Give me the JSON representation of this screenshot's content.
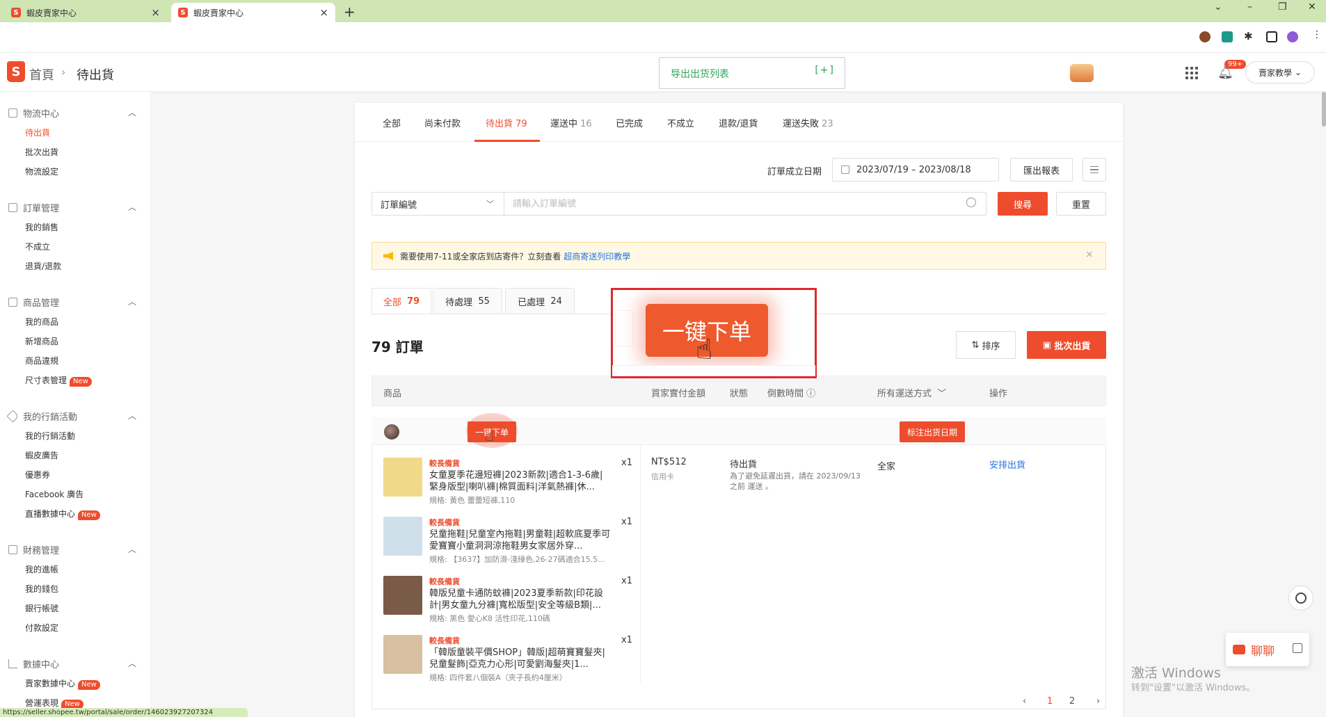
{
  "browser": {
    "tabs": [
      {
        "label": "蝦皮賣家中心"
      },
      {
        "label": "蝦皮賣家中心"
      }
    ],
    "new_tab": "+",
    "status_url": "https://seller.shopee.tw/portal/sale/order/146023927207324"
  },
  "header": {
    "breadcrumb_home": "首頁",
    "breadcrumb_sep": "›",
    "breadcrumb_current": "待出貨",
    "export_list_label": "导出出货列表",
    "export_list_plus": "[+]",
    "notif_badge": "99+",
    "seller_edu": "賣家教學"
  },
  "sidebar": {
    "sections": [
      {
        "title": "物流中心",
        "items": [
          {
            "label": "待出貨"
          },
          {
            "label": "批次出貨"
          },
          {
            "label": "物流設定"
          }
        ]
      },
      {
        "title": "訂單管理",
        "items": [
          {
            "label": "我的銷售"
          },
          {
            "label": "不成立"
          },
          {
            "label": "退貨/退款"
          }
        ]
      },
      {
        "title": "商品管理",
        "items": [
          {
            "label": "我的商品"
          },
          {
            "label": "新增商品"
          },
          {
            "label": "商品違規"
          },
          {
            "label": "尺寸表管理",
            "badge": "New"
          }
        ]
      },
      {
        "title": "我的行銷活動",
        "items": [
          {
            "label": "我的行銷活動"
          },
          {
            "label": "蝦皮廣告"
          },
          {
            "label": "優惠券"
          },
          {
            "label": "Facebook 廣告"
          },
          {
            "label": "直播數據中心",
            "badge": "New"
          }
        ]
      },
      {
        "title": "財務管理",
        "items": [
          {
            "label": "我的進帳"
          },
          {
            "label": "我的錢包"
          },
          {
            "label": "銀行帳號"
          },
          {
            "label": "付款設定"
          }
        ]
      },
      {
        "title": "數據中心",
        "items": [
          {
            "label": "賣家數據中心",
            "badge": "New"
          },
          {
            "label": "營運表現",
            "badge": "New"
          }
        ]
      }
    ]
  },
  "order_tabs": [
    {
      "label": "全部",
      "count": ""
    },
    {
      "label": "尚未付款",
      "count": ""
    },
    {
      "label": "待出貨",
      "count": "79"
    },
    {
      "label": "運送中",
      "count": "16"
    },
    {
      "label": "已完成",
      "count": ""
    },
    {
      "label": "不成立",
      "count": ""
    },
    {
      "label": "退款/退貨",
      "count": ""
    },
    {
      "label": "運送失敗",
      "count": "23"
    }
  ],
  "filters": {
    "date_label": "訂單成立日期",
    "date_range": "2023/07/19 – 2023/08/18",
    "export_report": "匯出報表",
    "search_field": "訂單編號",
    "search_placeholder": "請輸入訂單編號",
    "search_button": "搜尋",
    "reset_button": "重置"
  },
  "notice": {
    "text": "需要使用7-11或全家店到店寄件？立刻查看",
    "link": "超商寄送列印教學",
    "close": "×"
  },
  "sub_tabs": [
    {
      "label": "全部",
      "count": "79"
    },
    {
      "label": "待處理",
      "count": "55"
    },
    {
      "label": "已處理",
      "count": "24"
    }
  ],
  "list": {
    "order_count": "79 訂單",
    "sort_button": "排序",
    "batch_ship_button": "批次出貨",
    "columns": [
      "商品",
      "買家實付金額",
      "狀態",
      "倒數時間",
      "所有運送方式",
      "操作"
    ]
  },
  "order": {
    "one_click_button": "一键下单",
    "mark_date_button": "标注出货日期",
    "products": [
      {
        "tag": "較長備貨",
        "name": "女童夏季花邊短褲|2023新款|適合1-3-6歲|緊身版型|喇叭褲|棉質面料|洋氣熱褲|休...",
        "spec": "規格: 黃色 蕾蕾短褲,110",
        "qty": "x1",
        "color": "#f1d98a"
      },
      {
        "tag": "較長備貨",
        "name": "兒童拖鞋|兒童室內拖鞋|男童鞋|超軟底夏季可愛寶寶小童洞洞涼拖鞋男女家居外穿...",
        "spec": "規格: 【3637】加防滑-淺綠色,26-27碼適合15.5...",
        "qty": "x1",
        "color": "#cfe0ea"
      },
      {
        "tag": "較長備貨",
        "name": "韓版兒童卡通防蚊褲|2023夏季新款|印花設計|男女童九分褲|寬松版型|安全等級B類|...",
        "spec": "規格: 黑色 愛心K8 活性印花,110碼",
        "qty": "x1",
        "color": "#7a5a48"
      },
      {
        "tag": "較長備貨",
        "name": "「韓版童裝平價SHOP」韓版|超萌寶寶髮夾|兒童髮飾|亞克力心形|可愛劉海髮夾|1...",
        "spec": "規格: 四件套八個裝A（夾子長約4厘米）",
        "qty": "x1",
        "color": "#d8c1a0"
      }
    ],
    "price": "NT$512",
    "payment": "信用卡",
    "status": "待出貨",
    "status_note": "為了避免延遲出貨，請在 2023/09/13 之前 運送 。",
    "shipping": "全家",
    "action": "安排出貨"
  },
  "pagination": {
    "prev": "‹",
    "pages": [
      "1",
      "2"
    ],
    "next": "›"
  },
  "zoom": {
    "button_label": "一键下单"
  },
  "chat": {
    "label": "聊聊"
  },
  "os_watermark": {
    "line1": "激活 Windows",
    "line2": "转到\"设置\"以激活 Windows。"
  },
  "colors": {
    "brand": "#ee4d2d",
    "link": "#2673dd",
    "tabbar": "#cfe6b4"
  }
}
